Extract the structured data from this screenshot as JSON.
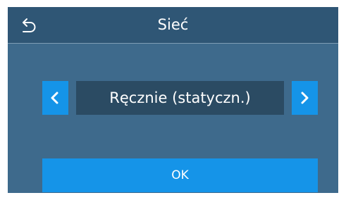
{
  "header": {
    "title": "Sieć",
    "back_icon": "back-arrow-icon"
  },
  "selector": {
    "value": "Ręcznie (statyczn.)",
    "prev_icon": "chevron-left-icon",
    "next_icon": "chevron-right-icon"
  },
  "actions": {
    "ok_label": "OK"
  },
  "colors": {
    "background": "#3e6a8c",
    "header": "#2f5675",
    "accent": "#1594e8",
    "value_box": "#2b4b63"
  }
}
